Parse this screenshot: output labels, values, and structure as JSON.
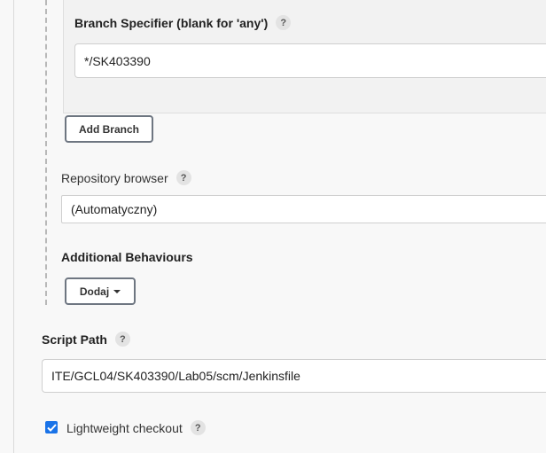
{
  "branch": {
    "specifier_label": "Branch Specifier (blank for 'any')",
    "specifier_value": "*/SK403390",
    "add_branch_label": "Add Branch"
  },
  "repository_browser": {
    "label": "Repository browser",
    "selected": "(Automatyczny)"
  },
  "additional_behaviours": {
    "label": "Additional Behaviours",
    "add_label": "Dodaj"
  },
  "script_path": {
    "label": "Script Path",
    "value": "ITE/GCL04/SK403390/Lab05/scm/Jenkinsfile"
  },
  "lightweight_checkout": {
    "label": "Lightweight checkout",
    "checked": true
  },
  "help_glyph": "?",
  "colors": {
    "accent": "#1a73e8",
    "button_border": "#6e7681"
  }
}
